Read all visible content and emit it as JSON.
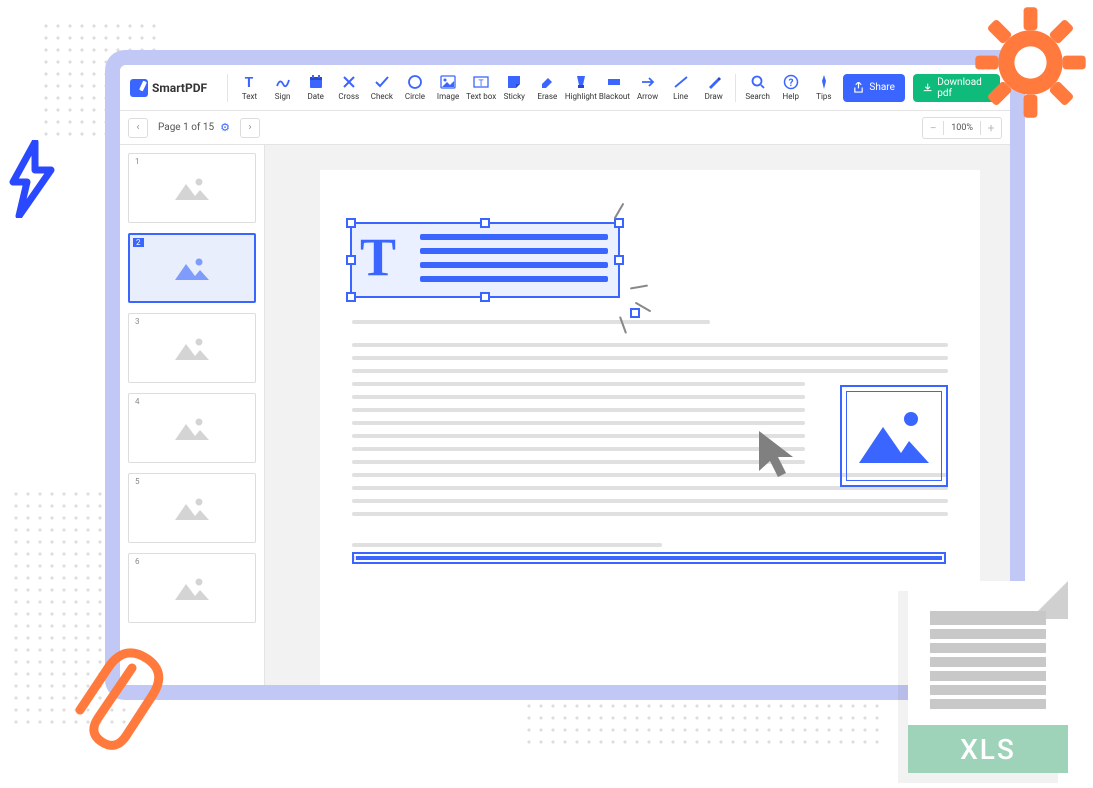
{
  "app": {
    "name": "SmartPDF"
  },
  "toolbar": {
    "tools": [
      {
        "label": "Text",
        "icon": "T"
      },
      {
        "label": "Sign",
        "icon": "sign"
      },
      {
        "label": "Date",
        "icon": "date"
      },
      {
        "label": "Cross",
        "icon": "cross"
      },
      {
        "label": "Check",
        "icon": "check"
      },
      {
        "label": "Circle",
        "icon": "circle"
      },
      {
        "label": "Image",
        "icon": "image"
      },
      {
        "label": "Text box",
        "icon": "textbox"
      },
      {
        "label": "Sticky",
        "icon": "sticky"
      },
      {
        "label": "Erase",
        "icon": "erase"
      },
      {
        "label": "Highlight",
        "icon": "highlight"
      },
      {
        "label": "Blackout",
        "icon": "blackout"
      },
      {
        "label": "Arrow",
        "icon": "arrow"
      },
      {
        "label": "Line",
        "icon": "line"
      },
      {
        "label": "Draw",
        "icon": "draw"
      }
    ],
    "utilities": [
      {
        "label": "Search",
        "icon": "search"
      },
      {
        "label": "Help",
        "icon": "help"
      },
      {
        "label": "Tips",
        "icon": "tips"
      }
    ],
    "share": "Share",
    "download": "Download pdf"
  },
  "pager": {
    "text": "Page 1 of 15"
  },
  "zoom": {
    "value": "100%"
  },
  "thumbnails": [
    {
      "num": "1",
      "active": false
    },
    {
      "num": "2",
      "active": true
    },
    {
      "num": "3",
      "active": false
    },
    {
      "num": "4",
      "active": false
    },
    {
      "num": "5",
      "active": false
    },
    {
      "num": "6",
      "active": false
    }
  ],
  "textbox": {
    "letter": "T"
  },
  "xls": {
    "label": "XLS"
  }
}
